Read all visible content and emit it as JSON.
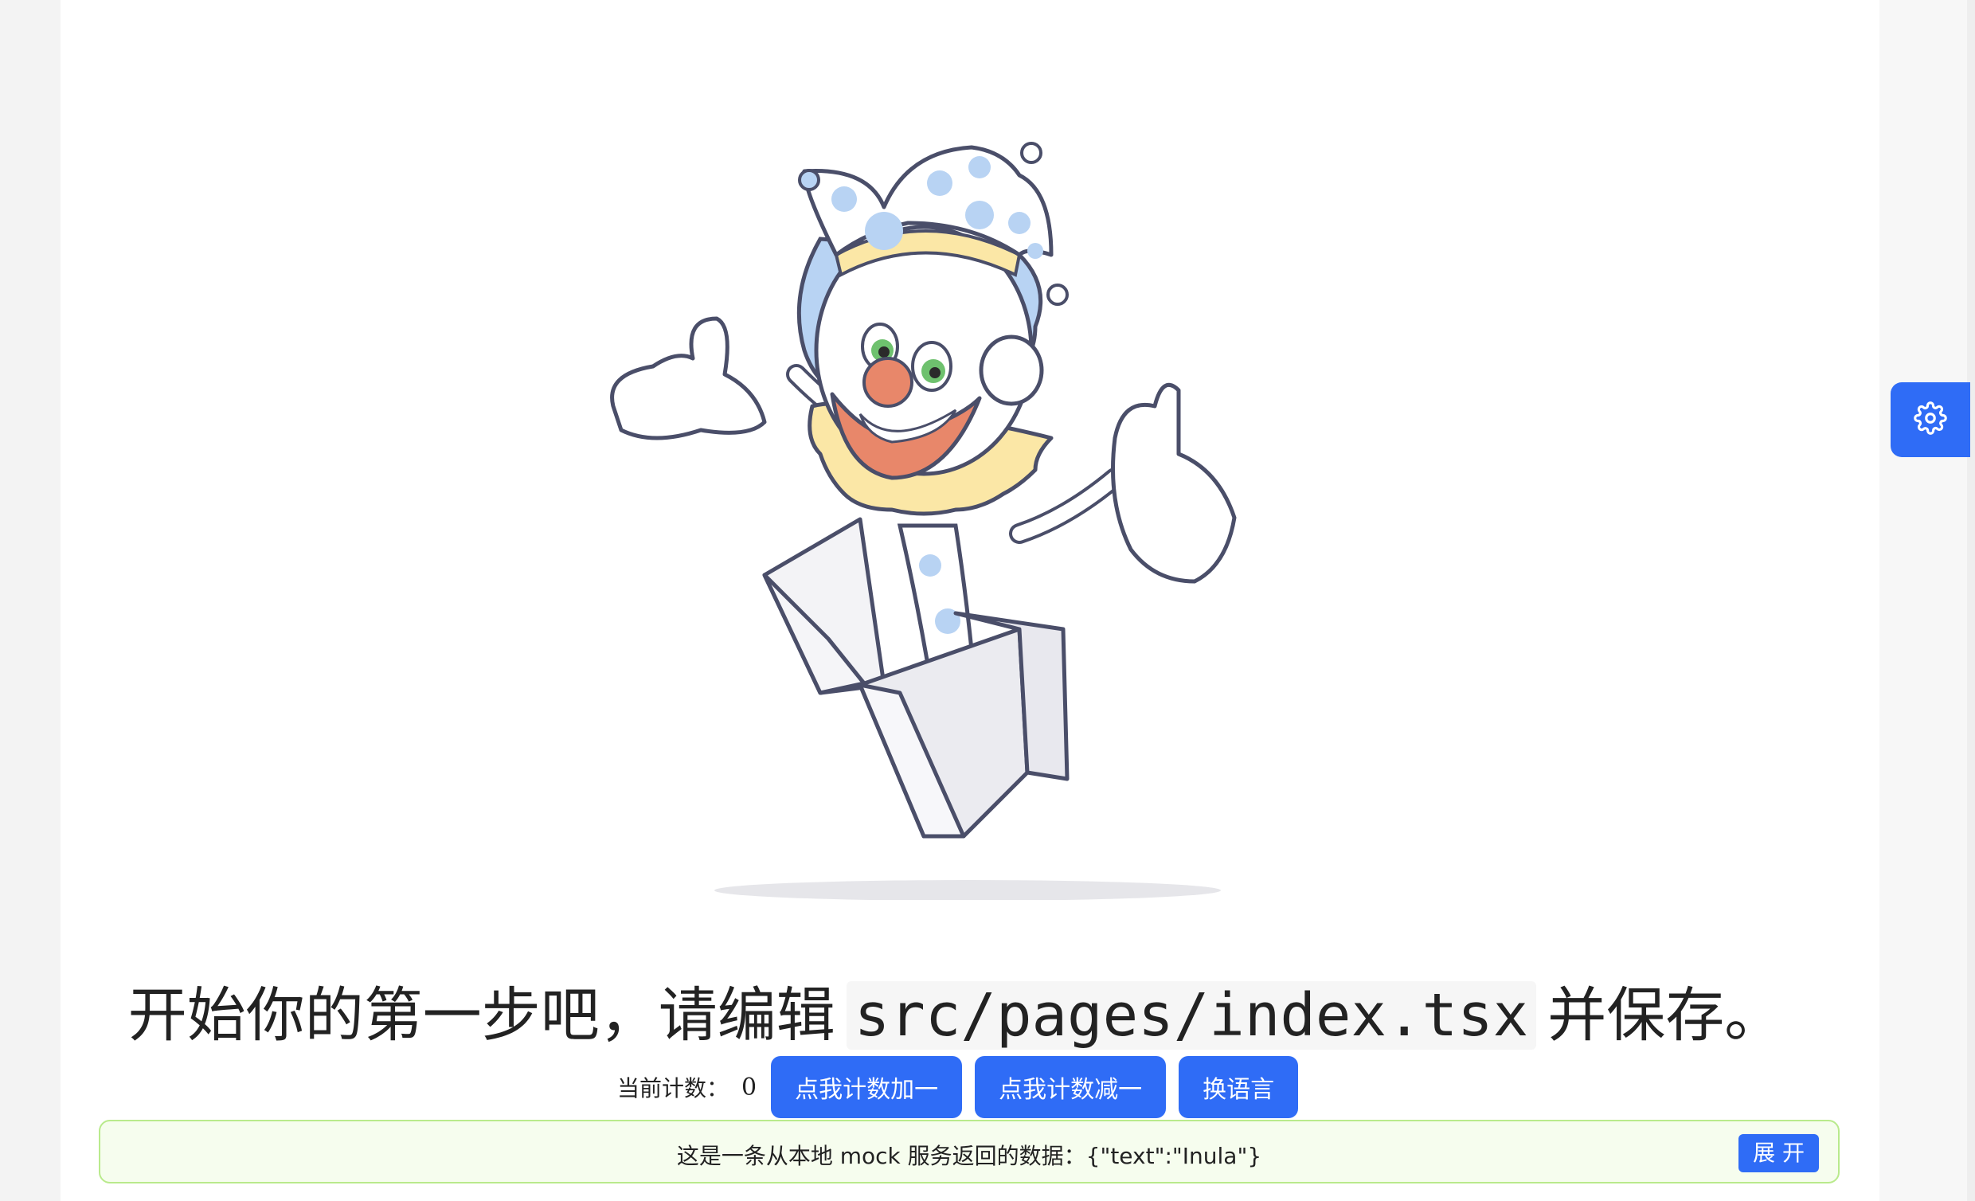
{
  "headline": {
    "prefix": "开始你的第一步吧，请编辑",
    "code": "src/pages/index.tsx",
    "suffix": "并保存。"
  },
  "counter": {
    "label": "当前计数：",
    "value": "0",
    "increment_label": "点我计数加一",
    "decrement_label": "点我计数减一",
    "language_label": "换语言"
  },
  "notice": {
    "text": "这是一条从本地 mock 服务返回的数据：{\"text\":\"Inula\"}",
    "expand_label": "展 开"
  },
  "icons": {
    "settings": "gear-icon",
    "hero": "jester-in-box-illustration"
  },
  "colors": {
    "primary": "#2f6cf6",
    "notice_bg": "#f6fdee",
    "notice_border": "#b9ea8c"
  }
}
